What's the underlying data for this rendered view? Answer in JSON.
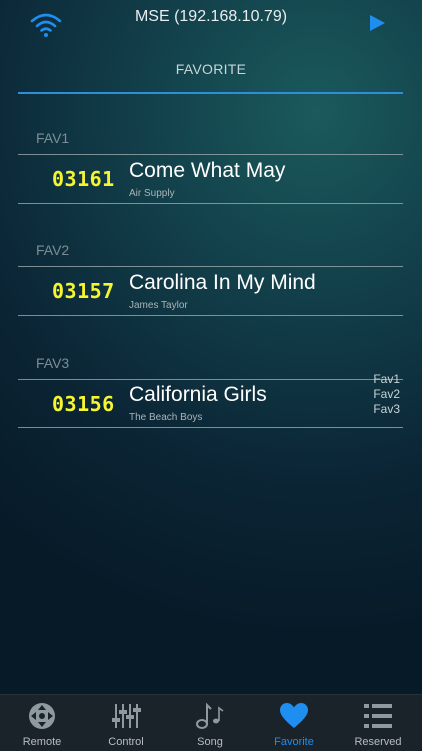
{
  "header": {
    "title": "MSE (192.168.10.79)",
    "subtitle": "FAVORITE",
    "icons": [
      "wifi-icon",
      "play-icon"
    ]
  },
  "favorites": [
    {
      "label": "FAV1",
      "code": "03161",
      "title": "Come What May",
      "artist": "Air Supply"
    },
    {
      "label": "FAV2",
      "code": "03157",
      "title": "Carolina In My Mind",
      "artist": "James Taylor"
    },
    {
      "label": "FAV3",
      "code": "03156",
      "title": "California Girls",
      "artist": "The Beach Boys"
    }
  ],
  "index": [
    "Fav1",
    "Fav2",
    "Fav3"
  ],
  "tabs": [
    {
      "label": "Remote",
      "icon": "dpad-icon",
      "active": false
    },
    {
      "label": "Control",
      "icon": "sliders-icon",
      "active": false
    },
    {
      "label": "Song",
      "icon": "music-notes-icon",
      "active": false
    },
    {
      "label": "Favorite",
      "icon": "heart-icon",
      "active": true
    },
    {
      "label": "Reserved",
      "icon": "list-icon",
      "active": false
    }
  ],
  "colors": {
    "accent": "#1f8ef1",
    "code_yellow": "#f5f530"
  }
}
